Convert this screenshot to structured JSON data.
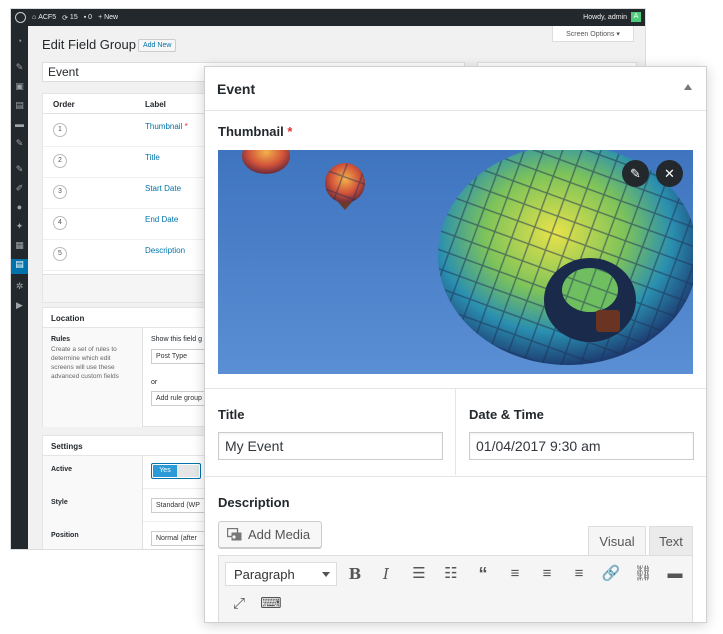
{
  "adminbar": {
    "site": "ACF5",
    "updates": "15",
    "comments": "0",
    "new": "New",
    "howdy": "Howdy, admin",
    "avatar_letter": "A"
  },
  "back": {
    "screen_options": "Screen Options ▾",
    "title": "Edit Field Group",
    "add_new": "Add New",
    "group_title": "Event",
    "columns": {
      "order": "Order",
      "label": "Label"
    },
    "fields": [
      {
        "order": "1",
        "label": "Thumbnail",
        "required": "*"
      },
      {
        "order": "2",
        "label": "Title"
      },
      {
        "order": "3",
        "label": "Start Date"
      },
      {
        "order": "4",
        "label": "End Date"
      },
      {
        "order": "5",
        "label": "Description"
      }
    ],
    "location": {
      "heading": "Location",
      "rules_title": "Rules",
      "rules_desc": "Create a set of rules to determine which edit screens will use these advanced custom fields",
      "show_if": "Show this field g",
      "param": "Post Type",
      "or": "or",
      "add_rule_group": "Add rule group"
    },
    "settings": {
      "heading": "Settings",
      "active_label": "Active",
      "active_value": "Yes",
      "style_label": "Style",
      "style_value": "Standard (WP",
      "position_label": "Position",
      "position_value": "Normal (after"
    }
  },
  "panel": {
    "title": "Event",
    "thumbnail_label": "Thumbnail",
    "required_mark": "*",
    "title_label": "Title",
    "title_value": "My Event",
    "datetime_label": "Date & Time",
    "datetime_value": "01/04/2017 9:30 am",
    "description_label": "Description",
    "add_media": "Add Media",
    "tab_visual": "Visual",
    "tab_text": "Text",
    "format_select": "Paragraph",
    "toolbar": [
      "bold-icon",
      "italic-icon",
      "bullet-list-icon",
      "numbered-list-icon",
      "blockquote-icon",
      "align-left-icon",
      "align-center-icon",
      "align-right-icon",
      "link-icon",
      "unlink-icon",
      "read-more-icon",
      "fullscreen-icon",
      "toolbar-toggle-icon"
    ]
  },
  "colors": {
    "wp_dark": "#23282d",
    "wp_blue": "#0073aa",
    "required": "#dc3232",
    "sky": "#4a80c8"
  }
}
